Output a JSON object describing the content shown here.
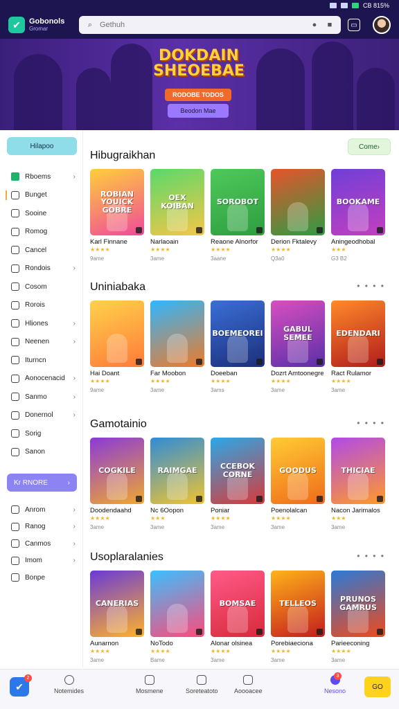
{
  "status": {
    "text": "CB 815%"
  },
  "header": {
    "logo_line1": "Gobonols",
    "logo_line2": "Gromar",
    "search_placeholder": "Gethuh",
    "icons": [
      "search-icon",
      "mic-icon",
      "camera-icon",
      "cast-icon"
    ]
  },
  "hero": {
    "title": "DOKDAIN SHEOEBAE",
    "chip": "RODOBE TODOS",
    "cta": "Beodon Mae"
  },
  "sidebar": {
    "top_button": "Hilapoo",
    "items": [
      {
        "label": "Rboems",
        "chevron": true,
        "icon": "home-icon"
      },
      {
        "label": "Bunget",
        "chevron": false,
        "icon": "search-icon",
        "active": true
      },
      {
        "label": "Sooine",
        "chevron": false,
        "icon": "grid-icon"
      },
      {
        "label": "Romog",
        "chevron": false,
        "icon": "folder-icon"
      },
      {
        "label": "Cancel",
        "chevron": false,
        "icon": "cart-icon"
      },
      {
        "label": "Rondois",
        "chevron": true,
        "icon": "list-icon"
      },
      {
        "label": "Cosom",
        "chevron": false,
        "icon": "chat-icon"
      },
      {
        "label": "Rorois",
        "chevron": false,
        "icon": "pin-icon"
      },
      {
        "label": "Hliones",
        "chevron": true,
        "icon": "calendar-icon"
      },
      {
        "label": "Neenen",
        "chevron": true,
        "icon": "people-icon"
      },
      {
        "label": "Iturncn",
        "chevron": false,
        "icon": "flag-icon"
      },
      {
        "label": "Aonocenacid",
        "chevron": true,
        "icon": "clock-icon"
      },
      {
        "label": "Sanmo",
        "chevron": true,
        "icon": "tag-icon"
      },
      {
        "label": "Donernol",
        "chevron": true,
        "icon": "bell-icon"
      },
      {
        "label": "Sorig",
        "chevron": false,
        "icon": "check-icon"
      },
      {
        "label": "Sanon",
        "chevron": false,
        "icon": "checkbox-icon"
      }
    ],
    "section_button": "Kr RNORE",
    "section_items": [
      {
        "label": "Anrom",
        "chevron": true,
        "icon": "gear-icon"
      },
      {
        "label": "Ranog",
        "chevron": true,
        "icon": "sliders-icon"
      },
      {
        "label": "Canmos",
        "chevron": true,
        "icon": "gamepad-icon"
      },
      {
        "label": "Imom",
        "chevron": true,
        "icon": "info-icon"
      },
      {
        "label": "Bonpe",
        "chevron": false,
        "icon": "logout-icon"
      }
    ]
  },
  "sections": [
    {
      "title": "Hibugraikhan",
      "more": "Come",
      "more_style": "button",
      "cards": [
        {
          "name": "Karl Finnane",
          "rating": "★★★★",
          "meta": "9ame",
          "thumb": "ROBIAN YOUICK GOBRE",
          "c1": "#ffcf3a",
          "c2": "#f04a9a"
        },
        {
          "name": "Narlaoain",
          "rating": "★★★★",
          "meta": "3ame",
          "thumb": "OEX KOIBAN",
          "c1": "#59d96b",
          "c2": "#f7c646"
        },
        {
          "name": "Reaone Alnorfor",
          "rating": "★★★★",
          "meta": "3aane",
          "thumb": "SOROBOT",
          "c1": "#4fc95a",
          "c2": "#2e9e41"
        },
        {
          "name": "Derion Fktalevy",
          "rating": "★★★★",
          "meta": "Q3a0",
          "thumb": "",
          "c1": "#e8532b",
          "c2": "#2d9c43"
        },
        {
          "name": "Aningeodhobal",
          "rating": "★★★",
          "meta": "G3 B2",
          "thumb": "BOOKAME",
          "c1": "#6f3fd8",
          "c2": "#c43fbf"
        }
      ]
    },
    {
      "title": "Uniniabaka",
      "more": "• • • •",
      "more_style": "dots",
      "cards": [
        {
          "name": "Hai Doant",
          "rating": "★★★★",
          "meta": "9ame",
          "thumb": "",
          "c1": "#ffd24a",
          "c2": "#ff7a3a"
        },
        {
          "name": "Far Moobon",
          "rating": "★★★★",
          "meta": "3ame",
          "thumb": "",
          "c1": "#2fb6ff",
          "c2": "#f07a28"
        },
        {
          "name": "Doeeban",
          "rating": "★★★★",
          "meta": "3ams",
          "thumb": "BOEMEOREI",
          "c1": "#3a6fd8",
          "c2": "#1c2f7a"
        },
        {
          "name": "Dozrt Amtoonegre",
          "rating": "★★★★",
          "meta": "3ame",
          "thumb": "GABUL SEMEE",
          "c1": "#d84fc0",
          "c2": "#5a2fa8"
        },
        {
          "name": "Ract Rulamor",
          "rating": "★★★★",
          "meta": "3ame",
          "thumb": "EDENDARI",
          "c1": "#ff8a2a",
          "c2": "#b01c1c"
        }
      ]
    },
    {
      "title": "Gamotainio",
      "more": "• • • •",
      "more_style": "dots",
      "cards": [
        {
          "name": "Doodendaahd",
          "rating": "★★★★",
          "meta": "3ame",
          "thumb": "COGKILE",
          "c1": "#8a3ad8",
          "c2": "#f0a830"
        },
        {
          "name": "Nc 6Oopon",
          "rating": "★★★",
          "meta": "3ame",
          "thumb": "RAIMGAE",
          "c1": "#2f8cd8",
          "c2": "#f0c430"
        },
        {
          "name": "Poniar",
          "rating": "★★★★",
          "meta": "3ame",
          "thumb": "CCEBOK CORNE",
          "c1": "#2aa8e8",
          "c2": "#d83a3a"
        },
        {
          "name": "Poenolalcan",
          "rating": "★★★★",
          "meta": "3ame",
          "thumb": "GOODUS",
          "c1": "#ffcc33",
          "c2": "#f06a1a"
        },
        {
          "name": "Nacon Jarimalos",
          "rating": "★★★",
          "meta": "3ame",
          "thumb": "THICIAE",
          "c1": "#b04ae8",
          "c2": "#ff9a2a"
        }
      ]
    },
    {
      "title": "Usoplaralanies",
      "more": "• • • •",
      "more_style": "dots",
      "cards": [
        {
          "name": "Aunarnon",
          "rating": "★★★★",
          "meta": "3ame",
          "thumb": "CANERIAS",
          "c1": "#6a3ad8",
          "c2": "#ffb22a"
        },
        {
          "name": "NoTodo",
          "rating": "★★★★",
          "meta": "Bame",
          "thumb": "",
          "c1": "#3ac0ff",
          "c2": "#ff4a7a"
        },
        {
          "name": "Alonar olsinea",
          "rating": "★★★★",
          "meta": "3ame",
          "thumb": "BOMSAE",
          "c1": "#ff5a8a",
          "c2": "#d82a3a"
        },
        {
          "name": "Porebiaeciona",
          "rating": "★★★★",
          "meta": "3ame",
          "thumb": "TELLEOS",
          "c1": "#ffb31a",
          "c2": "#c41c1c"
        },
        {
          "name": "Parieeconing",
          "rating": "★★★★",
          "meta": "3ame",
          "thumb": "PRUNOS GAMRUS",
          "c1": "#2a7ad8",
          "c2": "#f04a1a"
        }
      ]
    }
  ],
  "bottom_nav": {
    "app_badge": "2",
    "items": [
      {
        "label": "Notemides",
        "icon": "circle-icon"
      },
      {
        "label": "Mosmene",
        "icon": "square-icon"
      },
      {
        "label": "Soreteatoto",
        "icon": "user-icon"
      },
      {
        "label": "Aoooacee",
        "icon": "lock-icon"
      },
      {
        "label": "Nesono",
        "icon": "profile-icon",
        "active": true,
        "badge": "3"
      }
    ],
    "yellow_button": "GO"
  }
}
